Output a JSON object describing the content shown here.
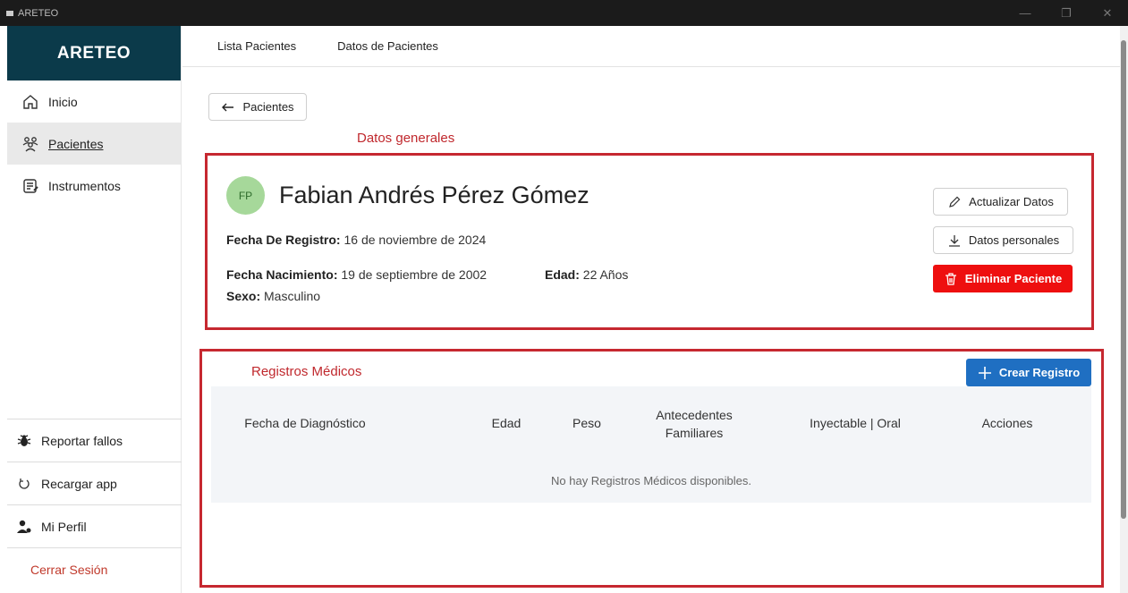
{
  "window": {
    "title": "ARETEO"
  },
  "sidebar": {
    "brand": "ARETEO",
    "items": [
      {
        "label": "Inicio",
        "icon": "home-icon"
      },
      {
        "label": "Pacientes",
        "icon": "patients-icon",
        "active": true
      },
      {
        "label": "Instrumentos",
        "icon": "instruments-icon"
      }
    ],
    "bottom": {
      "report": "Reportar fallos",
      "reload": "Recargar app",
      "profile": "Mi Perfil",
      "logout": "Cerrar Sesión"
    }
  },
  "topnav": {
    "tabs": [
      "Lista Pacientes",
      "Datos de Pacientes"
    ]
  },
  "back_button": "Pacientes",
  "annotations": {
    "general": "Datos generales",
    "records": "Registros Médicos"
  },
  "patient": {
    "initials": "FP",
    "name": "Fabian Andrés Pérez Gómez",
    "registration_label": "Fecha De Registro:",
    "registration_value": "16 de noviembre de 2024",
    "birth_label": "Fecha Nacimiento:",
    "birth_value": "19 de septiembre de 2002",
    "age_label": "Edad:",
    "age_value": "22 Años",
    "sex_label": "Sexo:",
    "sex_value": "Masculino"
  },
  "actions": {
    "update": "Actualizar Datos",
    "personal": "Datos personales",
    "delete": "Eliminar Paciente",
    "create": "Crear Registro"
  },
  "table": {
    "headers": [
      "Fecha de Diagnóstico",
      "Edad",
      "Peso",
      "Antecedentes Familiares",
      "Inyectable | Oral",
      "Acciones"
    ],
    "empty": "No hay Registros Médicos disponibles."
  },
  "colors": {
    "brand": "#0b3a4a",
    "danger": "#ee0f0f",
    "primary": "#1f6fc2",
    "annotation": "#c62830"
  }
}
